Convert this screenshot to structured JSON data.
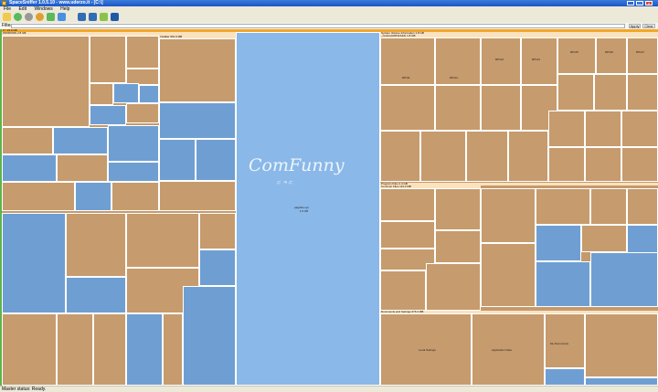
{
  "window": {
    "title": "SpaceSniffer 1.0.5.10 - www.uderzo.it - [C:\\]"
  },
  "menu": [
    "File",
    "Edit",
    "Windows",
    "Help"
  ],
  "toolbar": {
    "icons": [
      "open-icon",
      "back-icon",
      "stop-icon",
      "settings-icon",
      "refresh-icon",
      "zoom-icon",
      "disk-icon",
      "view-icon",
      "star-icon",
      "map-icon"
    ]
  },
  "filter": {
    "label": "Filter",
    "value": "",
    "apply": "Apply",
    "clear": "Clear"
  },
  "colors": {
    "folder": "#c69b6d",
    "file": "#6f9fd2",
    "selected": "#8ab8e8",
    "header": "#fbe2bf",
    "root_header": "#f5a623"
  },
  "treemap": {
    "root": "C:\\ 19.9 GB",
    "windows": "WINDOWS 2.8 GB",
    "installer": "Installer 661.9 MB",
    "pagefile": "pagefile.sys",
    "pagefile_size": "1.5 GB",
    "system_volume": "System Volume Information 1.8 GB",
    "restore": "_restore{A0F11A4A} 1.8 GB",
    "program_files": "Program Files 2.4 GB",
    "doc_settings": "Documents and Settings 676.3 MB",
    "common_files": "Common Files 113.2 MB",
    "appdata": "Application Data",
    "local_settings": "Local Settings",
    "my_documents": "My Documents",
    "cursor_labels": [
      "RP111",
      "RP112",
      "RP113",
      "RP114",
      "RP115",
      "RP116",
      "RP117"
    ]
  },
  "watermark": {
    "text": "ComFunny",
    "sub": "ㄷㅋㄷ"
  },
  "status": "Master status: Ready."
}
